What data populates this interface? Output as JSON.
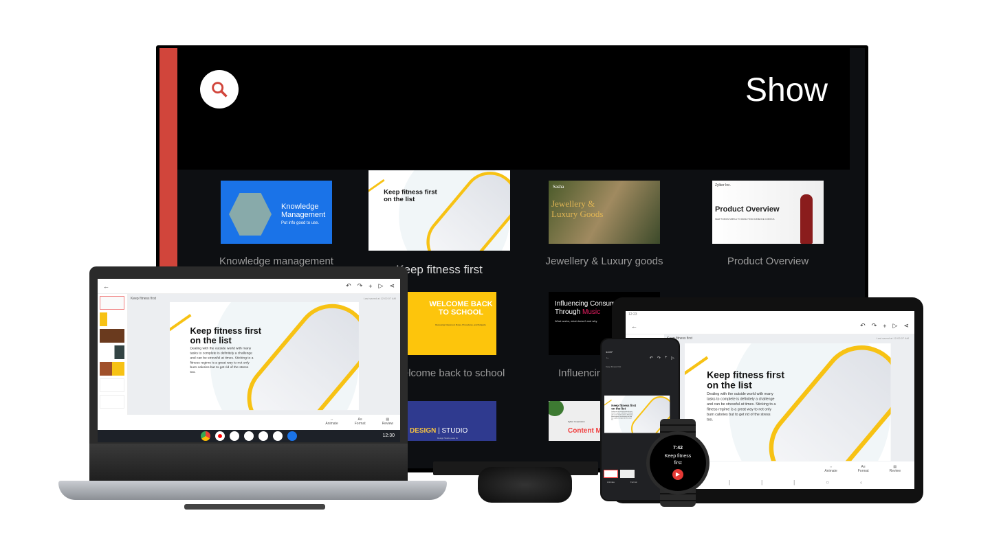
{
  "tv": {
    "title": "Show",
    "search_icon": "search-icon",
    "accent": "#d1453b",
    "cards": [
      {
        "label": "Knowledge management",
        "title": "Knowledge Management",
        "subtitle": "Put info good to use."
      },
      {
        "label": "Keep fitness first",
        "title": "Keep fitness first on the list"
      },
      {
        "label": "Jewellery & Luxury goods",
        "brand": "Sasha",
        "title": "Jewellery & Luxury Goods"
      },
      {
        "label": "Product Overview",
        "brand": "Zylker Inc.",
        "title": "Product Overview",
        "subtitle": "KEEP THINGS SIMPLE TO MAKE YOUR AUDIENCE CURIOUS."
      },
      {
        "label": "Welcome back to school",
        "title": "WELCOME BACK TO SCHOOL",
        "subtitle": "Reviewing Classroom Rules, Procedures, and Subjects"
      },
      {
        "label": "Influencing",
        "title_a": "Influencing Consum",
        "title_b": "Through ",
        "title_c": "Music",
        "subtitle": "What works, what doesn't and why"
      },
      {
        "title_a": "DESIGN",
        "title_b": "STUDIO",
        "subtitle": "Design Studio pace for"
      },
      {
        "brand": "Zylker Corporation",
        "title": "Content Marketi"
      }
    ]
  },
  "slide": {
    "doc_title": "Keep fitness first",
    "last_saved": "Last saved at 12:02:07 AM",
    "heading": "Keep fitness first on the list",
    "body": "Dealing with the outside world with many tasks to complete is definitely a challenge and can be stressful at times. Sticking to a fitness regime is a great way to not only burn calories but to get rid of the stress too.",
    "accent": "#f7c214"
  },
  "toolbar": {
    "animate": "Animate",
    "format": "Format",
    "review": "Review"
  },
  "laptop": {
    "clock": "12:30"
  },
  "tablet": {
    "clock": "12:23"
  },
  "phone": {
    "clock": "14:07"
  },
  "watch": {
    "time": "7:42",
    "title": "Keep fitness first"
  }
}
